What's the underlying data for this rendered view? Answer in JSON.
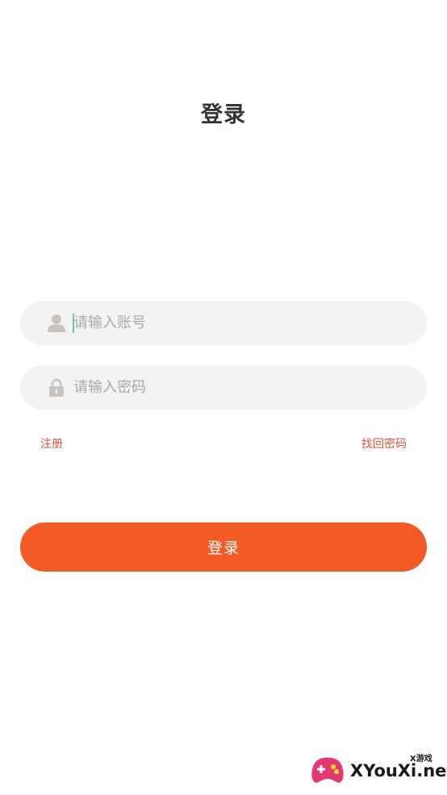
{
  "header": {
    "title": "登录"
  },
  "form": {
    "account": {
      "placeholder": "请输入账号",
      "value": "",
      "icon": "user-icon"
    },
    "password": {
      "placeholder": "请输入密码",
      "value": "",
      "icon": "lock-icon"
    }
  },
  "links": {
    "register": "注册",
    "forgot_password": "找回密码"
  },
  "actions": {
    "login_label": "登录"
  },
  "watermark": {
    "brand": "XYouXi.net",
    "sub": "X游戏"
  },
  "colors": {
    "accent": "#f25b26",
    "link": "#e2513e",
    "field_bg": "#f3f3f3",
    "caret": "#5ec8b8"
  }
}
